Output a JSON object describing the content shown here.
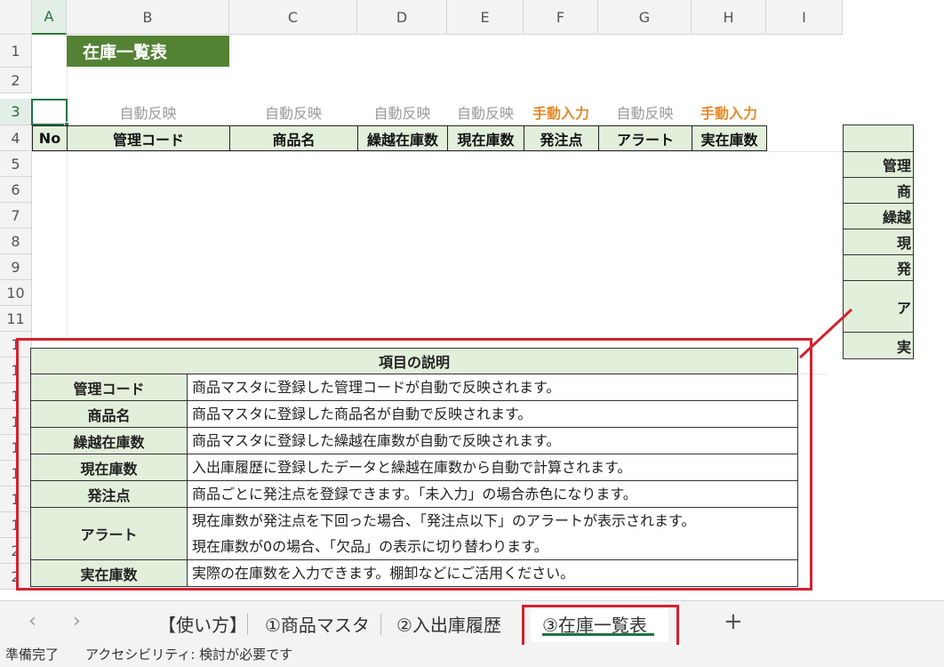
{
  "columns": [
    "A",
    "B",
    "C",
    "D",
    "E",
    "F",
    "G",
    "H",
    "I"
  ],
  "rows": [
    "1",
    "2",
    "3",
    "4",
    "5",
    "6",
    "7",
    "8",
    "9",
    "10",
    "11",
    "1",
    "1",
    "1",
    "1",
    "1",
    "1",
    "1",
    "1",
    "2",
    "2"
  ],
  "sheet_title": "在庫一覧表",
  "row3_labels": [
    {
      "text": "自動反映",
      "manual": false
    },
    {
      "text": "自動反映",
      "manual": false
    },
    {
      "text": "自動反映",
      "manual": false
    },
    {
      "text": "自動反映",
      "manual": false
    },
    {
      "text": "手動入力",
      "manual": true
    },
    {
      "text": "自動反映",
      "manual": false
    },
    {
      "text": "手動入力",
      "manual": true
    }
  ],
  "table_headers": [
    "No",
    "管理コード",
    "商品名",
    "繰越在庫数",
    "現在庫数",
    "発注点",
    "アラート",
    "実在庫数"
  ],
  "right_table_cells": [
    "管理",
    "商",
    "繰越",
    "現",
    "発",
    "ア",
    "実"
  ],
  "explanation": {
    "title": "項目の説明",
    "rows": [
      {
        "key": "管理コード",
        "lines": [
          "商品マスタに登録した管理コードが自動で反映されます。"
        ]
      },
      {
        "key": "商品名",
        "lines": [
          "商品マスタに登録した商品名が自動で反映されます。"
        ]
      },
      {
        "key": "繰越在庫数",
        "lines": [
          "商品マスタに登録した繰越在庫数が自動で反映されます。"
        ]
      },
      {
        "key": "現在庫数",
        "lines": [
          "入出庫履歴に登録したデータと繰越在庫数から自動で計算されます。"
        ]
      },
      {
        "key": "発注点",
        "lines": [
          "商品ごとに発注点を登録できます。「未入力」の場合赤色になります。"
        ]
      },
      {
        "key": "アラート",
        "lines": [
          "現在庫数が発注点を下回った場合、「発注点以下」のアラートが表示されます。",
          "現在庫数が0の場合、「欠品」の表示に切り替わります。"
        ]
      },
      {
        "key": "実在庫数",
        "lines": [
          "実際の在庫数を入力できます。棚卸などにご活用ください。"
        ]
      }
    ]
  },
  "sheet_tabs": [
    "【使い方】",
    "①商品マスタ",
    "②入出庫履歴",
    "③在庫一覧表"
  ],
  "active_tab": "③在庫一覧表",
  "nav": {
    "prev": "‹",
    "next": "›",
    "add": "+"
  },
  "status_text": "準備完了　　アクセシビリティ: 検討が必要です",
  "colors": {
    "title_bg": "#548235",
    "header_bg": "#e2efda",
    "manual": "#e38b2c",
    "auto": "#9a9a9a",
    "highlight": "#d5212e",
    "accent": "#217346"
  }
}
